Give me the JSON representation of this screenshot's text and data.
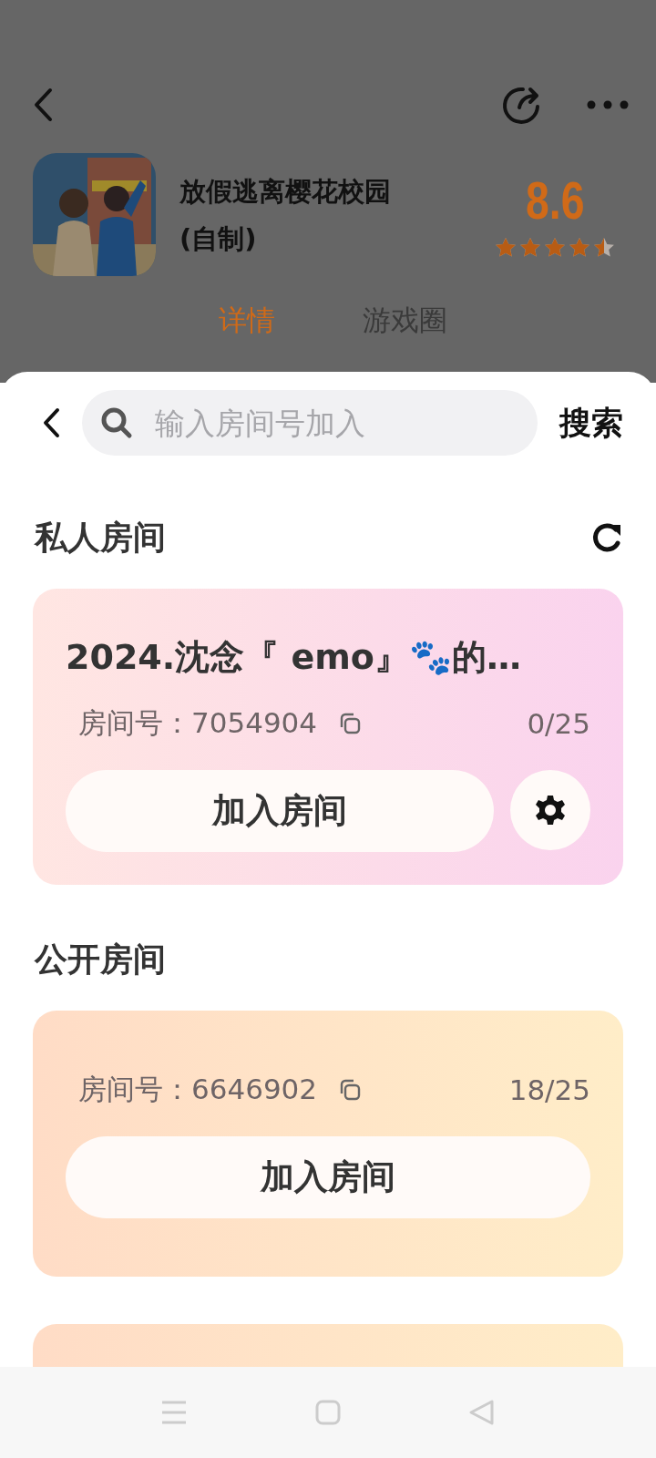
{
  "app": {
    "title_lines": [
      "放假逃离樱花校园",
      "(自制)"
    ],
    "rating": "8.6",
    "stars": 4.5
  },
  "tabs": [
    {
      "label": "详情",
      "selected": true
    },
    {
      "label": "游戏圈",
      "selected": false
    }
  ],
  "sheet": {
    "search": {
      "placeholder": "输入房间号加入"
    },
    "search_button": "搜索",
    "sections": [
      {
        "kind": "private",
        "title": "私人房间",
        "refresh": true,
        "rooms": [
          {
            "kind": "full",
            "name": "2024.沈念『 emo』🐾的…",
            "room_label": "房间号：",
            "room_number": "7054904",
            "occupancy": "0/25",
            "join_button": "加入房间",
            "settings": true
          }
        ]
      },
      {
        "kind": "public",
        "title": "公开房间",
        "rooms": [
          {
            "kind": "full",
            "room_label": "房间号：",
            "room_number": "6646902",
            "occupancy": "18/25",
            "join_button": "加入房间",
            "settings": false
          },
          {
            "kind": "covered"
          }
        ]
      }
    ]
  }
}
